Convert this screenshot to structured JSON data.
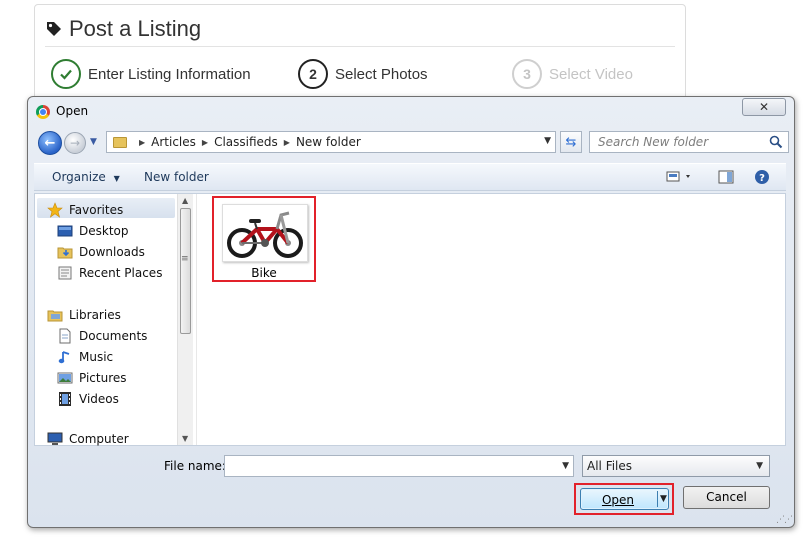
{
  "page": {
    "title": "Post a Listing",
    "steps": [
      {
        "number": "",
        "label": "Enter Listing Information",
        "state": "done"
      },
      {
        "number": "2",
        "label": "Select Photos",
        "state": "active"
      },
      {
        "number": "3",
        "label": "Select Video",
        "state": "disabled"
      }
    ]
  },
  "dialog": {
    "title": "Open",
    "close_glyph": "✕",
    "breadcrumbs": [
      "Articles",
      "Classifieds",
      "New folder"
    ],
    "search_placeholder": "Search New folder",
    "toolbar": {
      "organize_label": "Organize",
      "new_folder_label": "New folder"
    },
    "nav": {
      "favorites": {
        "label": "Favorites",
        "items": [
          "Desktop",
          "Downloads",
          "Recent Places"
        ]
      },
      "libraries": {
        "label": "Libraries",
        "items": [
          "Documents",
          "Music",
          "Pictures",
          "Videos"
        ]
      },
      "computer_label": "Computer"
    },
    "files": [
      {
        "name": "Bike"
      }
    ],
    "footer": {
      "file_name_label": "File name:",
      "file_name_value": "",
      "file_type": "All Files",
      "open_label": "Open",
      "cancel_label": "Cancel"
    }
  },
  "colors": {
    "highlight": "#e2212a",
    "accent": "#2f6fd3",
    "bike_frame": "#b3121b"
  }
}
